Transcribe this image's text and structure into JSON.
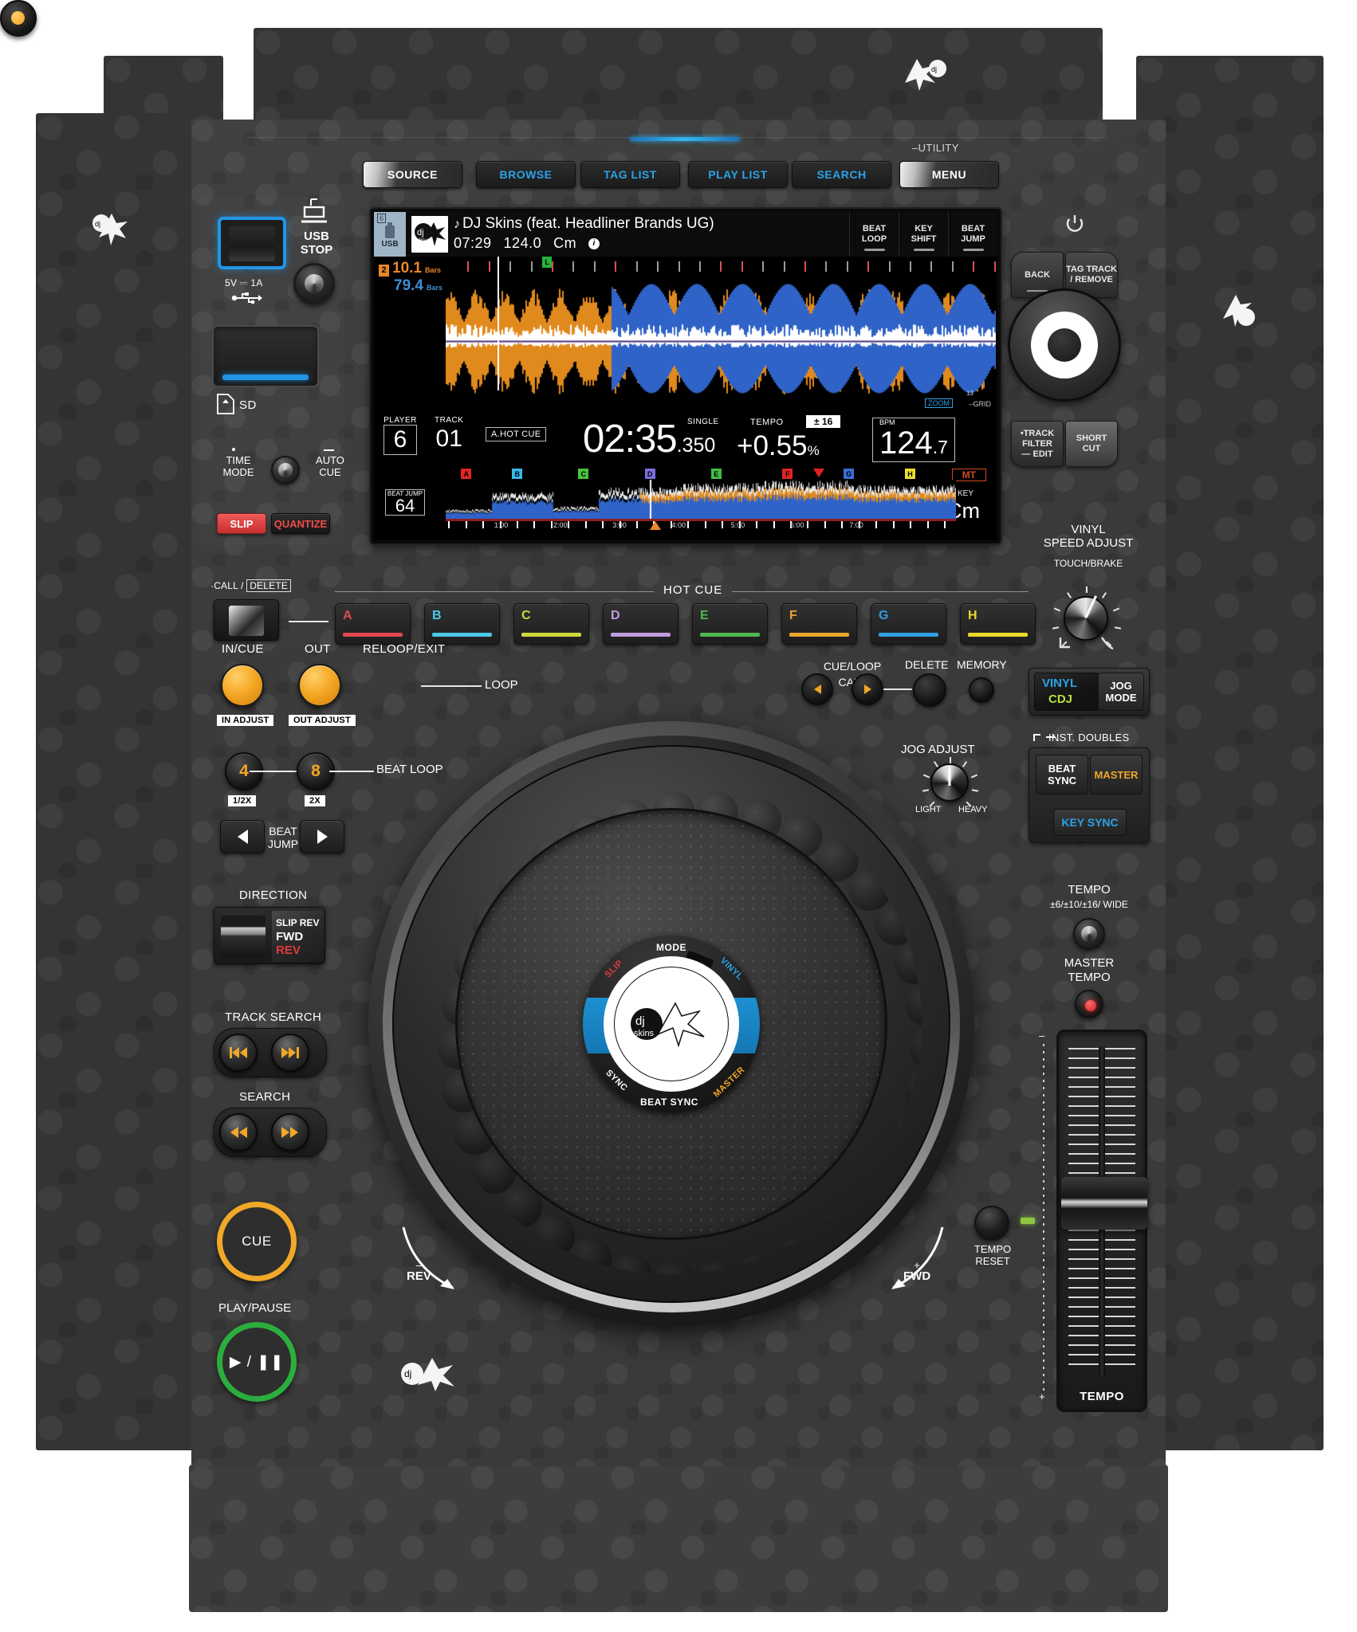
{
  "nav": {
    "buttons": [
      {
        "id": "source",
        "label": "SOURCE",
        "lit": true
      },
      {
        "id": "browse",
        "label": "BROWSE",
        "lit": false
      },
      {
        "id": "taglist",
        "label": "TAG LIST",
        "lit": false
      },
      {
        "id": "playlist",
        "label": "PLAY LIST",
        "lit": false
      },
      {
        "id": "search",
        "label": "SEARCH",
        "lit": false
      },
      {
        "id": "menu",
        "label": "MENU",
        "lit": true
      }
    ],
    "utility_label": "–UTILITY"
  },
  "screen": {
    "usb": {
      "slot_number": "6",
      "label": "USB"
    },
    "track": {
      "title": "DJ Skins (feat. Headliner Brands UG)",
      "note_glyph": "♪",
      "duration": "07:29",
      "bpm": "124.0",
      "key": "Cm",
      "info_glyph": "i"
    },
    "soft_buttons": [
      {
        "line1": "BEAT",
        "line2": "LOOP"
      },
      {
        "line1": "KEY",
        "line2": "SHIFT"
      },
      {
        "line1": "BEAT",
        "line2": "JUMP"
      }
    ],
    "bars": {
      "remain_badge": "2",
      "remain_value": "10.1",
      "remain_unit": "Bars",
      "total_value": "79.4",
      "total_unit": "Bars"
    },
    "cue_marker_letter": "L",
    "zoom_tag": "ZOOM",
    "grid_tag": "GRID",
    "zoom_level": "13",
    "info": {
      "player_caption": "PLAYER",
      "player_value": "6",
      "track_caption": "TRACK",
      "track_value": "01",
      "hotcue_badge": "A.HOT CUE",
      "time_main": "02:35",
      "time_ms": ".350",
      "single_label": "SINGLE",
      "tempo_label": "TEMPO",
      "tempo_range": "± 16",
      "pitch_value": "+0.55",
      "pitch_unit": "%",
      "bpm_caption": "BPM",
      "bpm_value": "124",
      "bpm_decimal": ".7",
      "mt_badge": "MT",
      "key_caption": "KEY",
      "key_value": "Cm",
      "beat_jump_caption": "BEAT JUMP",
      "beat_jump_value": "64"
    },
    "cue_points": [
      {
        "letter": "A",
        "color": "#e02424",
        "pos": 3
      },
      {
        "letter": "B",
        "color": "#39b9e8",
        "pos": 13
      },
      {
        "letter": "C",
        "color": "#49c23d",
        "pos": 26
      },
      {
        "letter": "D",
        "color": "#7b6fe0",
        "pos": 39
      },
      {
        "letter": "E",
        "color": "#3fbe45",
        "pos": 52
      },
      {
        "letter": "F",
        "color": "#e02424",
        "pos": 66
      },
      {
        "letter": "G",
        "color": "#3b6fd6",
        "pos": 78
      },
      {
        "letter": "H",
        "color": "#e8e02a",
        "pos": 90
      }
    ],
    "timeline_labels": [
      "1:00",
      "2:00",
      "3:00",
      "4:00",
      "5:00",
      "6:00",
      "7:00"
    ]
  },
  "media_bay": {
    "usb_power": "5V ⎓ 1A",
    "usb_stop": "USB\nSTOP",
    "usb_stop_line1": "USB",
    "usb_stop_line2": "STOP",
    "sd_label": "SD",
    "time_mode_line1": "TIME",
    "time_mode_line2": "MODE",
    "auto_cue_line1": "AUTO",
    "auto_cue_line2": "CUE",
    "slip_label": "SLIP",
    "quantize_label": "QUANTIZE"
  },
  "hot_cue": {
    "section_label": "HOT CUE",
    "call_label": "·CALL /",
    "delete_label": "DELETE",
    "pads": [
      {
        "letter": "A",
        "color": "#e0494f"
      },
      {
        "letter": "B",
        "color": "#4ec8e8"
      },
      {
        "letter": "C",
        "color": "#cdd93a"
      },
      {
        "letter": "D",
        "color": "#c09de0"
      },
      {
        "letter": "E",
        "color": "#4fb84f"
      },
      {
        "letter": "F",
        "color": "#e8a72a"
      },
      {
        "letter": "G",
        "color": "#2f9fe0"
      },
      {
        "letter": "H",
        "color": "#e8d82a"
      }
    ]
  },
  "loop": {
    "in_cue": "IN/CUE",
    "out": "OUT",
    "reloop_exit": "RELOOP/EXIT",
    "loop_word": "LOOP",
    "in_adjust": "IN ADJUST",
    "out_adjust": "OUT ADJUST",
    "beat_loop_word": "BEAT LOOP",
    "beat_left_value": "4",
    "beat_right_value": "8",
    "half_x": "1/2X",
    "two_x": "2X"
  },
  "cue_loop_call": {
    "caption": "CUE/LOOP",
    "call": "CALL",
    "delete": "DELETE",
    "memory": "MEMORY"
  },
  "beat_jump": {
    "line1": "BEAT",
    "line2": "JUMP"
  },
  "direction": {
    "caption": "DIRECTION",
    "slip_rev": "SLIP REV",
    "fwd": "FWD",
    "rev": "REV"
  },
  "search": {
    "track_search": "TRACK SEARCH",
    "search": "SEARCH"
  },
  "transport": {
    "cue": "CUE",
    "play_pause_caption": "PLAY/PAUSE",
    "play_glyph": "▶ / ❚❚"
  },
  "jog": {
    "mode": "MODE",
    "slip": "SLIP",
    "vinyl": "VINYL",
    "sync": "SYNC",
    "master": "MASTER",
    "beat_sync": "BEAT SYNC",
    "rev_sign": "–",
    "rev": "REV",
    "fwd_sign": "+",
    "fwd": "FWD",
    "logo_top": "dj",
    "logo_bottom": "skins"
  },
  "jog_adjust": {
    "caption": "JOG ADJUST",
    "light": "LIGHT",
    "heavy": "HEAVY"
  },
  "rotary": {
    "back": "BACK",
    "tag_track_line1": "TAG TRACK",
    "tag_track_line2": "/ REMOVE",
    "track_filter_line1": "•TRACK",
    "track_filter_line2": "FILTER",
    "track_filter_line3": "— EDIT",
    "short_cut_line1": "SHORT",
    "short_cut_line2": "CUT"
  },
  "vinyl_speed": {
    "line1": "VINYL",
    "line2": "SPEED ADJUST",
    "touch_brake": "TOUCH/BRAKE",
    "vinyl": "VINYL",
    "cdj": "CDJ",
    "jog_mode_line1": "JOG",
    "jog_mode_line2": "MODE"
  },
  "sync_section": {
    "inst_doubles": "INST. DOUBLES",
    "beat_sync_line1": "BEAT",
    "beat_sync_line2": "SYNC",
    "master": "MASTER",
    "key_sync": "KEY SYNC"
  },
  "tempo_section": {
    "caption": "TEMPO",
    "ranges": "±6/±10/±16/ WIDE",
    "master_tempo_line1": "MASTER",
    "master_tempo_line2": "TEMPO",
    "tempo_reset_line1": "TEMPO",
    "tempo_reset_line2": "RESET",
    "fader_label": "TEMPO",
    "scale_minus": "–",
    "scale_plus": "+"
  },
  "colors": {
    "accent_blue": "#2aa3e8",
    "cue_orange": "#f0a829",
    "play_green": "#2bae3e",
    "slip_red": "#ef5a5a",
    "key_sync_blue": "#2aa3e8",
    "master_amber": "#f0a829"
  }
}
